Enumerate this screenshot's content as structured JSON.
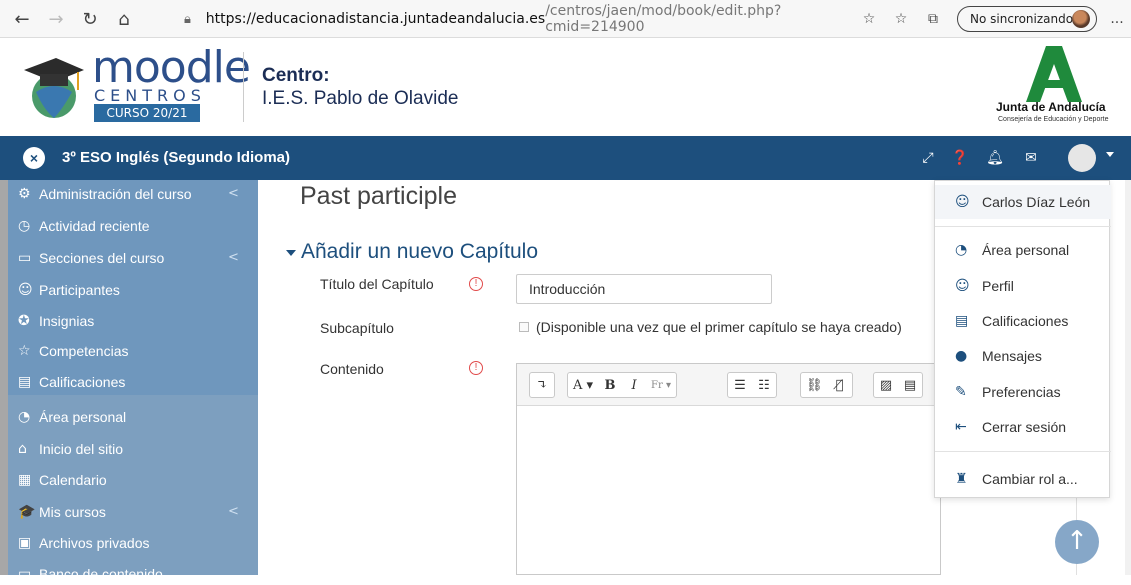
{
  "browser": {
    "url_host": "https://educacionadistancia.juntadeandalucia.es",
    "url_path": "/centros/jaen/mod/book/edit.php?cmid=214900",
    "sync_label": "No sincronizando",
    "more": "..."
  },
  "header": {
    "logo_word": "moodle",
    "logo_sub": "CENTROS",
    "logo_badge": "CURSO 20/21",
    "centro_label": "Centro:",
    "centro_name": "I.E.S. Pablo de Olavide",
    "junta_title": "Junta de Andalucía",
    "junta_sub": "Consejería de Educación y Deporte"
  },
  "navbar": {
    "close": "×",
    "course_title": "3º ESO Inglés (Segundo Idioma)"
  },
  "sidebar": {
    "items": [
      {
        "icon": "⚙",
        "label": "Administración del curso",
        "chevron": "<"
      },
      {
        "icon": "◷",
        "label": "Actividad reciente"
      },
      {
        "icon": "▭",
        "label": "Secciones del curso",
        "chevron": "<"
      },
      {
        "icon": "☺",
        "label": "Participantes"
      },
      {
        "icon": "✪",
        "label": "Insignias"
      },
      {
        "icon": "☆",
        "label": "Competencias"
      },
      {
        "icon": "▤",
        "label": "Calificaciones"
      },
      {
        "icon": "◔",
        "label": "Área personal"
      },
      {
        "icon": "⌂",
        "label": "Inicio del sitio"
      },
      {
        "icon": "▦",
        "label": "Calendario"
      },
      {
        "icon": "🎓",
        "label": "Mis cursos",
        "chevron": "<"
      },
      {
        "icon": "▣",
        "label": "Archivos privados"
      },
      {
        "icon": "▭",
        "label": "Banco de contenido"
      }
    ]
  },
  "main": {
    "page_title": "Past participle",
    "section_title": "Añadir un nuevo Capítulo",
    "titulo_label": "Título del Capítulo",
    "titulo_value": "Introducción",
    "subcap_label": "Subcapítulo",
    "subcap_text": "(Disponible una vez que el primer capítulo se haya creado)",
    "contenido_label": "Contenido",
    "required_mark": "!"
  },
  "editor_toolbar": {
    "collapse": "↴",
    "font_color": "A ▾",
    "bold": "B",
    "italic": "I",
    "styles": "Fr ▾",
    "ul": "☰",
    "ol": "☷",
    "link": "⛓",
    "unlink": "⛓̸",
    "image": "▨",
    "media": "▤"
  },
  "user_menu": {
    "user_name": "Carlos Díaz León",
    "items": [
      {
        "icon": "◔",
        "label": "Área personal"
      },
      {
        "icon": "☺",
        "label": "Perfil"
      },
      {
        "icon": "▤",
        "label": "Calificaciones"
      },
      {
        "icon": "●",
        "label": "Mensajes"
      },
      {
        "icon": "✎",
        "label": "Preferencias"
      },
      {
        "icon": "⇤",
        "label": "Cerrar sesión"
      }
    ],
    "switch_role": "Cambiar rol a..."
  },
  "colors": {
    "navbar": "#1d4f7d",
    "sidebar": "#7d9fbf",
    "accent": "#1d4f7d"
  }
}
